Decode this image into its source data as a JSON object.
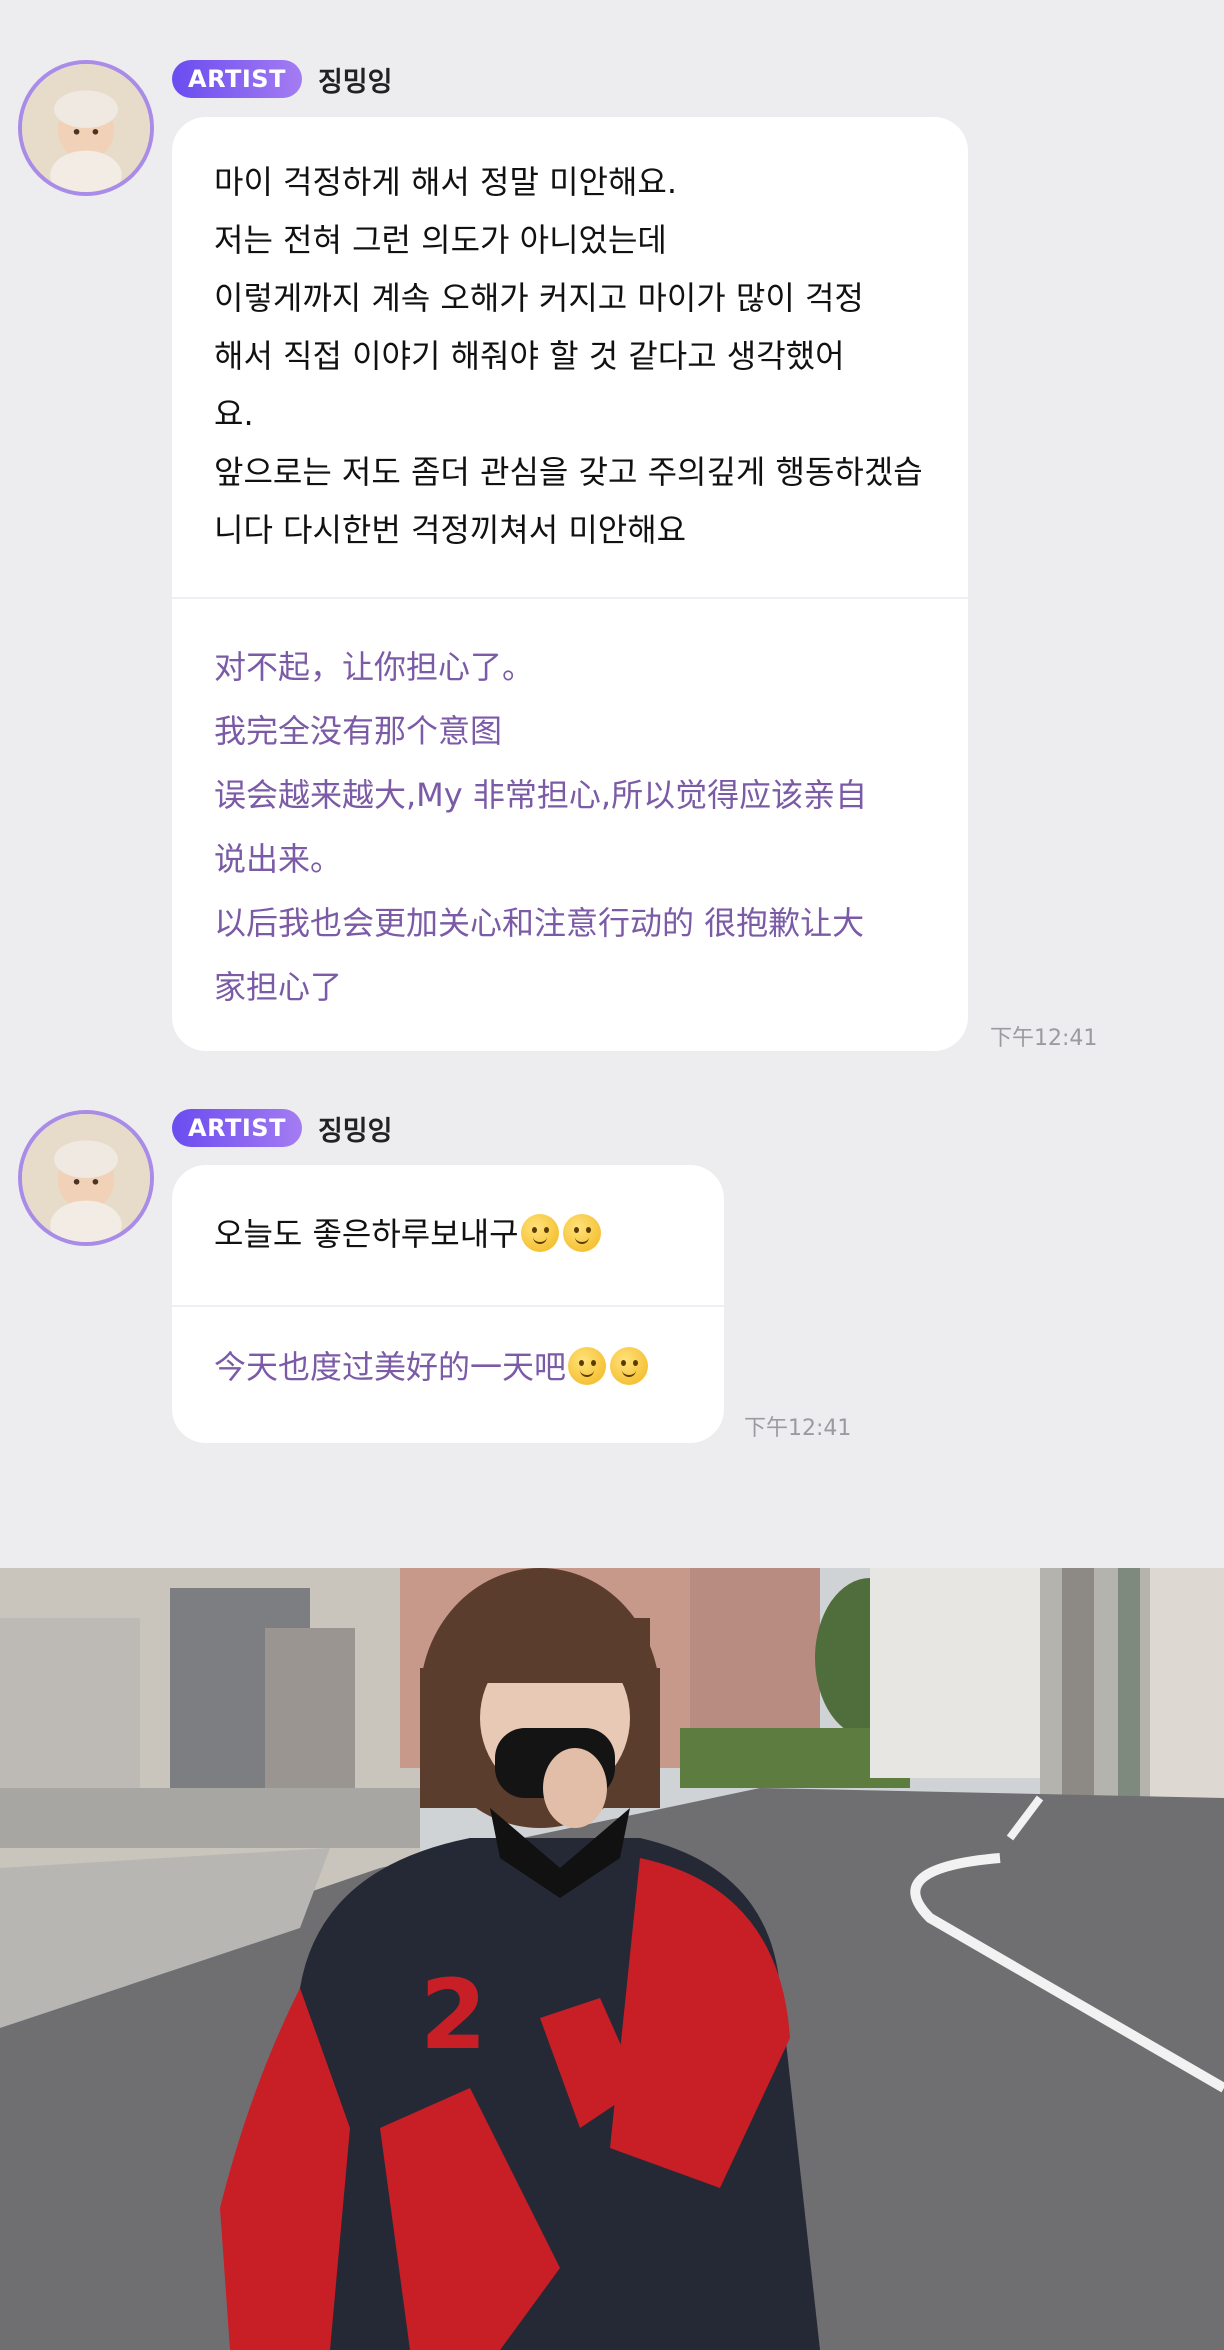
{
  "messages": [
    {
      "badge": "ARTIST",
      "name": "징밍잉",
      "korean_lines": [
        "마이 걱정하게 해서 정말 미안해요.",
        "저는 전혀 그런 의도가 아니었는데",
        "이렇게까지 계속 오해가 커지고  마이가 많이 걱정",
        "해서 직접 이야기 해줘야 할 것 같다고 생각했어",
        "요.",
        "앞으로는 저도 좀더 관심을 갖고 주의깊게 행동하겠습",
        "니다 다시한번 걱정끼쳐서 미안해요"
      ],
      "chinese_lines": [
        "对不起，让你担心了。",
        "我完全没有那个意图",
        "误会越来越大,My 非常担心,所以觉得应该亲自",
        "说出来。",
        "以后我也会更加关心和注意行动的 很抱歉让大",
        "家担心了"
      ],
      "time": "下午12:41"
    },
    {
      "badge": "ARTIST",
      "name": "징밍잉",
      "korean_text": "오늘도 좋은하루보내구",
      "chinese_text": "今天也度过美好的一天吧",
      "emoji_icons": [
        "slightly-smiling-face-icon",
        "slightly-smiling-face-icon"
      ],
      "time": "下午12:41"
    }
  ],
  "photo": {
    "subject": "person in red and black jacket on street",
    "jacket_text": "2"
  },
  "colors": {
    "badge_start": "#6a4cf0",
    "badge_end": "#a47cf2",
    "translation_text": "#7b5aa6",
    "background": "#ededf0"
  }
}
